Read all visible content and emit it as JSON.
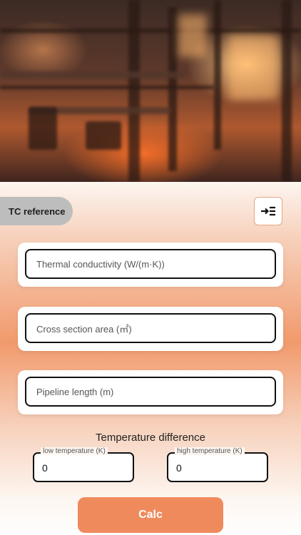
{
  "header": {
    "tc_reference_label": "TC reference",
    "menu_icon": "indent-list-icon"
  },
  "inputs": {
    "thermal_conductivity_placeholder": "Thermal conductivity (W/(m·K))",
    "cross_section_area_placeholder": "Cross section area (㎡)",
    "pipeline_length_placeholder": "Pipeline length (m)"
  },
  "temperature": {
    "title": "Temperature difference",
    "low_label": "low temperature (K)",
    "low_value": "0",
    "high_label": "high temperature (K)",
    "high_value": "0"
  },
  "actions": {
    "calc_label": "Calc"
  },
  "colors": {
    "accent": "#ef8a5d",
    "tab_gray": "#bdbdbd",
    "border_dark": "#111111"
  }
}
